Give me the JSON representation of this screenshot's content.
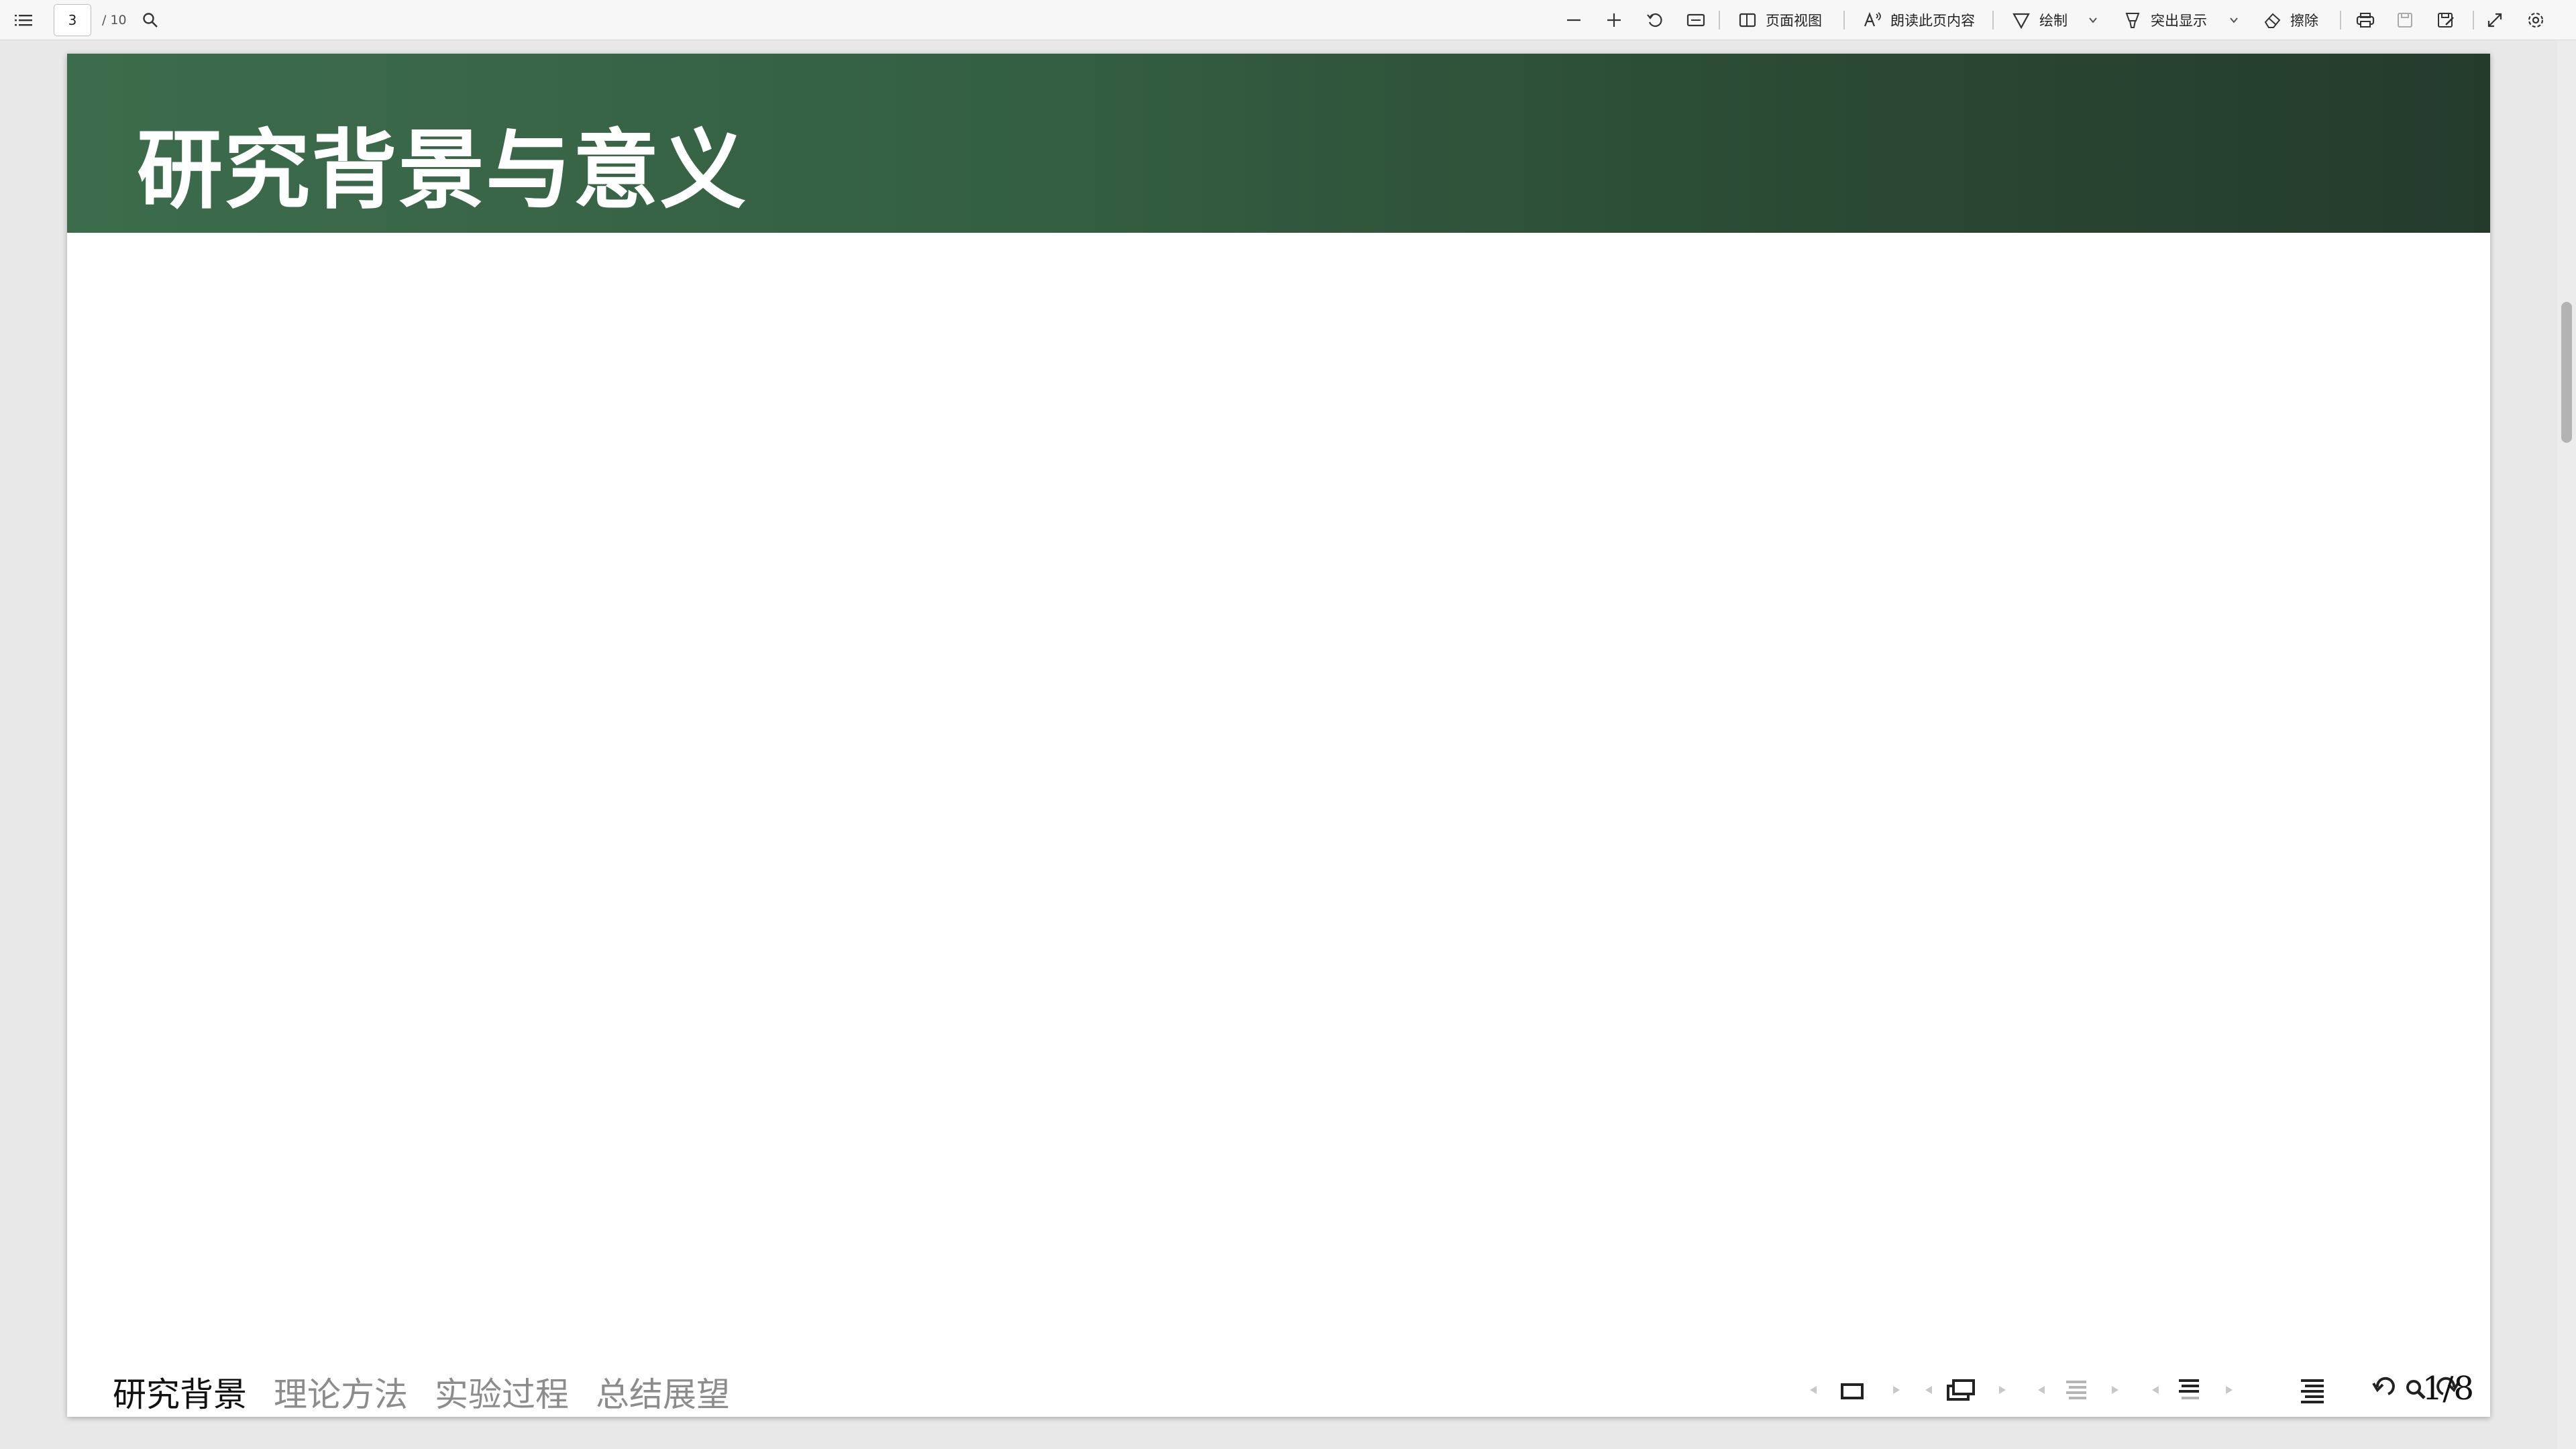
{
  "toolbar": {
    "page_current": "3",
    "page_total": "/ 10",
    "page_view_label": "页面视图",
    "read_aloud_label": "朗读此页内容",
    "draw_label": "绘制",
    "highlight_label": "突出显示",
    "erase_label": "擦除"
  },
  "slide": {
    "title": "研究背景与意义",
    "sections": [
      "研究背景",
      "理论方法",
      "实验过程",
      "总结展望"
    ],
    "active_section": "研究背景",
    "counter": "1/8"
  },
  "colors": {
    "header_start": "#3c6c4b",
    "header_end": "#243b2c",
    "section_active": "#111111",
    "section_inactive": "#8c8c8c"
  }
}
